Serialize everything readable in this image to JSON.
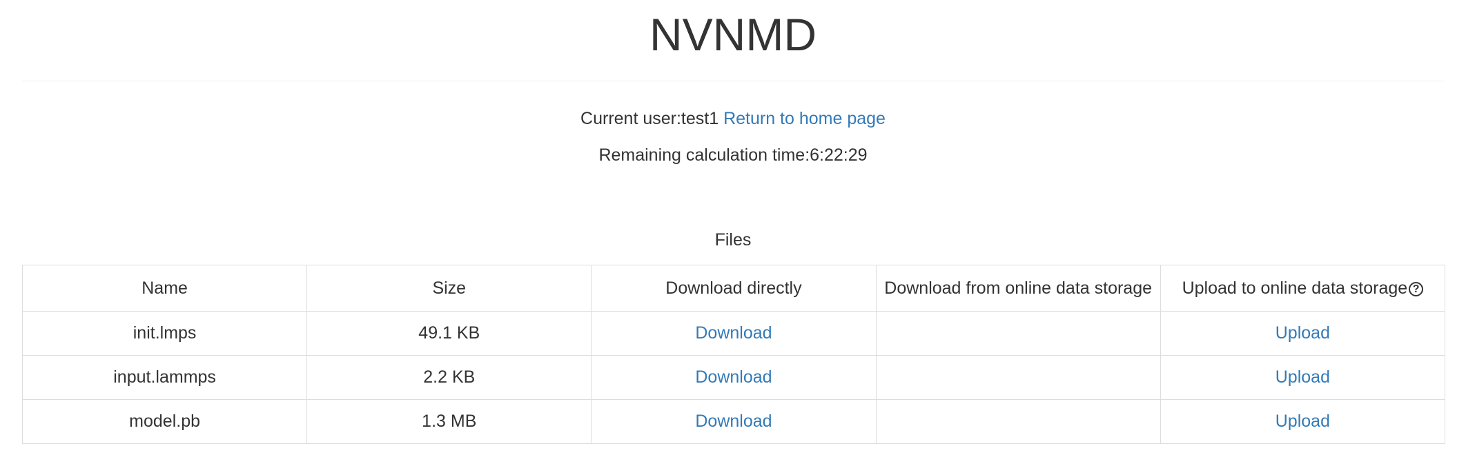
{
  "header": {
    "title": "NVNMD"
  },
  "user_info": {
    "label": "Current user:test1",
    "home_link": "Return to home page",
    "remaining_time": "Remaining calculation time:6:22:29"
  },
  "files": {
    "caption": "Files",
    "columns": [
      "Name",
      "Size",
      "Download directly",
      "Download from online data storage",
      "Upload to online data storage"
    ],
    "help_icon": "question-circle-icon",
    "help_glyph": "?",
    "rows": [
      {
        "name": "init.lmps",
        "size": "49.1 KB",
        "download": "Download",
        "online_download": "",
        "upload": "Upload"
      },
      {
        "name": "input.lammps",
        "size": "2.2 KB",
        "download": "Download",
        "online_download": "",
        "upload": "Upload"
      },
      {
        "name": "model.pb",
        "size": "1.3 MB",
        "download": "Download",
        "online_download": "",
        "upload": "Upload"
      }
    ]
  },
  "colors": {
    "text": "#333333",
    "link": "#337ab7",
    "border": "#dddddd"
  }
}
